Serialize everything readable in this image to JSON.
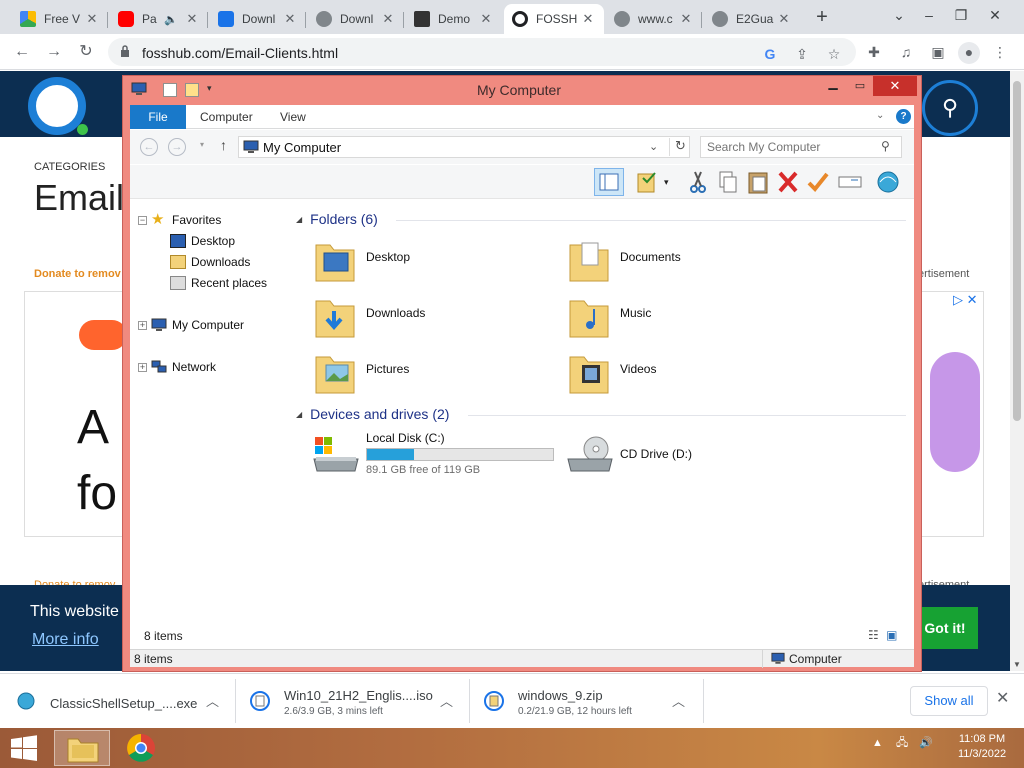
{
  "browser": {
    "tabs": [
      {
        "title": "Free V",
        "icon": "drive-icon"
      },
      {
        "title": "Pa",
        "icon": "youtube-icon"
      },
      {
        "title": "Downl",
        "icon": "infinity-icon"
      },
      {
        "title": "Downl",
        "icon": "globe-icon"
      },
      {
        "title": "Demo",
        "icon": "building-icon"
      },
      {
        "title": "FOSSH",
        "icon": "fosshub-icon"
      },
      {
        "title": "www.c",
        "icon": "globe-icon"
      },
      {
        "title": "E2Gua",
        "icon": "globe-icon"
      }
    ],
    "active_tab_index": 5,
    "url": "fosshub.com/Email-Clients.html"
  },
  "webpage": {
    "categories_label": "CATEGORIES",
    "page_title": "Email",
    "donate_text": "Donate to remov",
    "donate_text_2": "Donate to remov",
    "advertisement_label": "ertisement",
    "advertisement_label_2": "ertisement",
    "ad_text_line1": "A",
    "ad_text_line2": "fo",
    "cookie_text": "This website",
    "more_info": "More info",
    "got_it": "Got it!"
  },
  "explorer": {
    "title": "My Computer",
    "ribbon_tabs": [
      "File",
      "Computer",
      "View"
    ],
    "address": "My Computer",
    "search_placeholder": "Search My Computer",
    "nav_tree": {
      "favorites": "Favorites",
      "favorites_items": [
        "Desktop",
        "Downloads",
        "Recent places"
      ],
      "my_computer": "My Computer",
      "network": "Network"
    },
    "folders_header": "Folders (6)",
    "folders": [
      {
        "name": "Desktop",
        "icon": "desktop-folder-icon"
      },
      {
        "name": "Documents",
        "icon": "documents-folder-icon"
      },
      {
        "name": "Downloads",
        "icon": "downloads-folder-icon"
      },
      {
        "name": "Music",
        "icon": "music-folder-icon"
      },
      {
        "name": "Pictures",
        "icon": "pictures-folder-icon"
      },
      {
        "name": "Videos",
        "icon": "videos-folder-icon"
      }
    ],
    "devices_header": "Devices and drives (2)",
    "drives": [
      {
        "name": "Local Disk (C:)",
        "free_text": "89.1 GB free of 119 GB",
        "used_fraction": 0.25
      },
      {
        "name": "CD Drive (D:)"
      }
    ],
    "item_count": "8 items",
    "status_left": "8 items",
    "status_right": "Computer"
  },
  "downloads": [
    {
      "name": "ClassicShellSetup_....exe",
      "status": ""
    },
    {
      "name": "Win10_21H2_Englis....iso",
      "status": "2.6/3.9 GB, 3 mins left"
    },
    {
      "name": "windows_9.zip",
      "status": "0.2/21.9 GB, 12 hours left"
    }
  ],
  "downloads_show_all": "Show all",
  "taskbar": {
    "time": "11:08 PM",
    "date": "11/3/2022"
  },
  "colors": {
    "window_frame": "#f08a80",
    "accent_blue": "#1979ca",
    "site_header": "#0c2e51",
    "got_it_green": "#17a233"
  }
}
